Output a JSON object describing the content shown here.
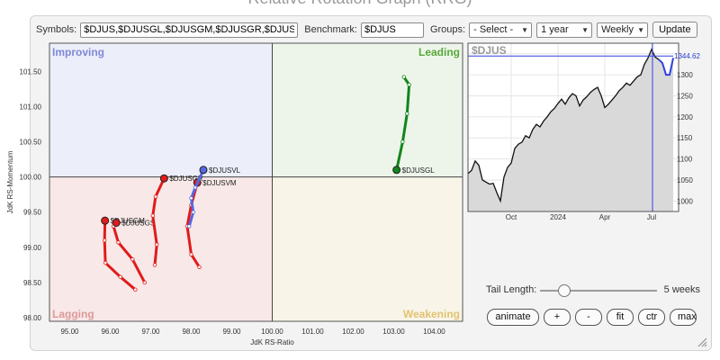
{
  "header": {
    "title": "Relative Rotation Graph (RRG)"
  },
  "toolbar": {
    "symbols_label": "Symbols:",
    "symbols_value": "$DJUS,$DJUSGL,$DJUSGM,$DJUSGR,$DJUSGS",
    "benchmark_label": "Benchmark:",
    "benchmark_value": "$DJUS",
    "groups_label": "Groups:",
    "groups_value": "- Select -",
    "period_value": "1 year",
    "interval_value": "Weekly",
    "update_label": "Update"
  },
  "quadrants": {
    "improving": "Improving",
    "leading": "Leading",
    "lagging": "Lagging",
    "weakening": "Weakening"
  },
  "colors": {
    "improving_bg": "#eceef9",
    "improving_text": "#8088d8",
    "leading_bg": "#edf5ea",
    "leading_text": "#58a83a",
    "lagging_bg": "#f8e8e8",
    "lagging_text": "#dc9a9a",
    "weakening_bg": "#f8f5e8",
    "weakening_text": "#e2c270",
    "red_series": "#e01b1b",
    "blue_series": "#5468e0",
    "green_series": "#12851a",
    "price_line": "#111111",
    "price_fill": "#d9d9d9",
    "highlight": "#3040e0"
  },
  "tail": {
    "label": "Tail Length:",
    "value_text": "5 weeks",
    "weeks": 5,
    "max_weeks": 20
  },
  "controls": [
    "animate",
    "+",
    "-",
    "fit",
    "ctr",
    "max"
  ],
  "chart_data": [
    {
      "type": "scatter",
      "title": "",
      "xlabel": "JdK RS-Ratio",
      "ylabel": "JdK RS-Momentum",
      "xlim": [
        94.5,
        104.7
      ],
      "ylim": [
        97.95,
        101.9
      ],
      "xticks": [
        95.0,
        96.0,
        97.0,
        98.0,
        99.0,
        100.0,
        101.0,
        102.0,
        103.0,
        104.0
      ],
      "xtick_labels": [
        "95.00",
        "96.00",
        "97.00",
        "98.00",
        "99.00",
        "100.00",
        "101.00",
        "102.00",
        "103.00",
        "104.00"
      ],
      "yticks": [
        98.0,
        98.5,
        99.0,
        99.5,
        100.0,
        100.5,
        101.0,
        101.5
      ],
      "ytick_labels": [
        "98.00",
        "98.50",
        "99.00",
        "99.50",
        "100.00",
        "100.50",
        "101.00",
        "101.50"
      ],
      "center": [
        100,
        100
      ],
      "series": [
        {
          "name": "$DJUSGL",
          "color": "#12851a",
          "x": [
            103.25,
            103.38,
            103.33,
            103.22,
            103.07
          ],
          "y": [
            101.42,
            101.31,
            100.9,
            100.5,
            100.1
          ]
        },
        {
          "name": "$DJUSGM",
          "color": "#e01b1b",
          "x": [
            96.62,
            96.25,
            95.88,
            95.86,
            95.87
          ],
          "y": [
            98.4,
            98.58,
            98.78,
            99.1,
            99.38
          ]
        },
        {
          "name": "$DJUSGS",
          "color": "#e01b1b",
          "x": [
            96.85,
            96.55,
            96.2,
            96.08,
            96.15
          ],
          "y": [
            98.5,
            98.83,
            99.07,
            99.3,
            99.35
          ]
        },
        {
          "name": "$DJUSGR",
          "color": "#e01b1b",
          "x": [
            97.1,
            97.15,
            97.05,
            97.12,
            97.33
          ],
          "y": [
            98.75,
            99.04,
            99.45,
            99.72,
            99.98
          ]
        },
        {
          "name": "$DJUSVM",
          "color": "#e01b1b",
          "x": [
            98.2,
            98.0,
            97.9,
            98.0,
            98.15
          ],
          "y": [
            98.72,
            98.9,
            99.3,
            99.6,
            99.92
          ]
        },
        {
          "name": "$DJUSVL",
          "color": "#5468e0",
          "x": [
            97.95,
            98.05,
            98.0,
            98.1,
            98.3
          ],
          "y": [
            99.3,
            99.5,
            99.7,
            99.85,
            100.1
          ]
        }
      ]
    },
    {
      "type": "area",
      "title": "$DJUS",
      "x_tick_labels": [
        "Oct",
        "2024",
        "Apr",
        "Jul"
      ],
      "x_tick_index": [
        12,
        25,
        38,
        51
      ],
      "ylim": [
        975,
        1375
      ],
      "yticks": [
        1000,
        1050,
        1100,
        1150,
        1200,
        1250,
        1300,
        1350
      ],
      "ytick_labels": [
        "1000",
        "1050",
        "1100",
        "1150",
        "1200",
        "1250",
        "1300",
        "1350"
      ],
      "last_value": 1344.62,
      "last_value_label": "1344.62",
      "highlight_start_index": 53,
      "values": [
        1065,
        1073,
        1095,
        1085,
        1050,
        1045,
        1040,
        1042,
        1020,
        1000,
        1057,
        1080,
        1090,
        1125,
        1135,
        1140,
        1155,
        1150,
        1170,
        1182,
        1176,
        1190,
        1200,
        1212,
        1220,
        1232,
        1242,
        1230,
        1245,
        1255,
        1250,
        1226,
        1240,
        1248,
        1258,
        1265,
        1270,
        1250,
        1222,
        1230,
        1240,
        1250,
        1262,
        1270,
        1280,
        1275,
        1285,
        1295,
        1300,
        1325,
        1340,
        1360,
        1342,
        1336,
        1328,
        1300,
        1300,
        1340
      ]
    }
  ]
}
